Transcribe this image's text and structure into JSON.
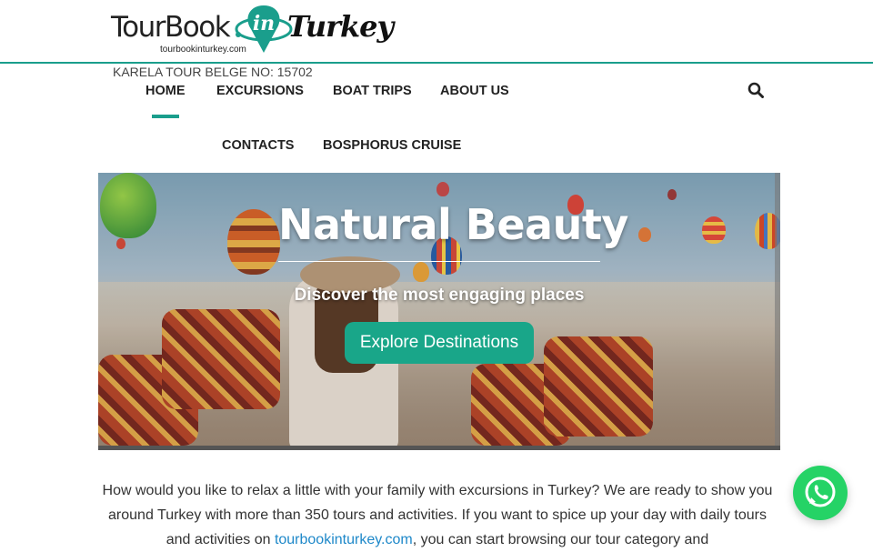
{
  "header": {
    "logo": {
      "brand_main": "TourBook",
      "brand_in": "in",
      "brand_turkey": "Turkey",
      "brand_url": "tourbookinturkey.com"
    },
    "license_text": "KARELA TOUR BELGE NO: 15702"
  },
  "nav": {
    "items": [
      {
        "label": "HOME",
        "active": true
      },
      {
        "label": "EXCURSIONS"
      },
      {
        "label": "BOAT TRIPS"
      },
      {
        "label": "ABOUT US"
      },
      {
        "label": "CONTACTS"
      },
      {
        "label": "BOSPHORUS CRUISE"
      }
    ],
    "search_icon": "search-icon"
  },
  "hero": {
    "title": "Natural Beauty",
    "subtitle": "Discover the most engaging places",
    "cta_label": "Explore Destinations"
  },
  "intro": {
    "text_before_link": "How would you like to relax a little with your family with excursions in Turkey? We are ready to show you around Turkey with more than 350 tours and activities. If you want to spice up your day with daily tours and activities on ",
    "link_text": "tourbookinturkey.com",
    "text_after_link": ", you can start browsing our tour category and"
  },
  "whatsapp": {
    "icon": "whatsapp-icon"
  },
  "colors": {
    "accent": "#1a9e8c",
    "cta": "#19a689",
    "link": "#1e88c9",
    "whatsapp": "#25d366"
  }
}
